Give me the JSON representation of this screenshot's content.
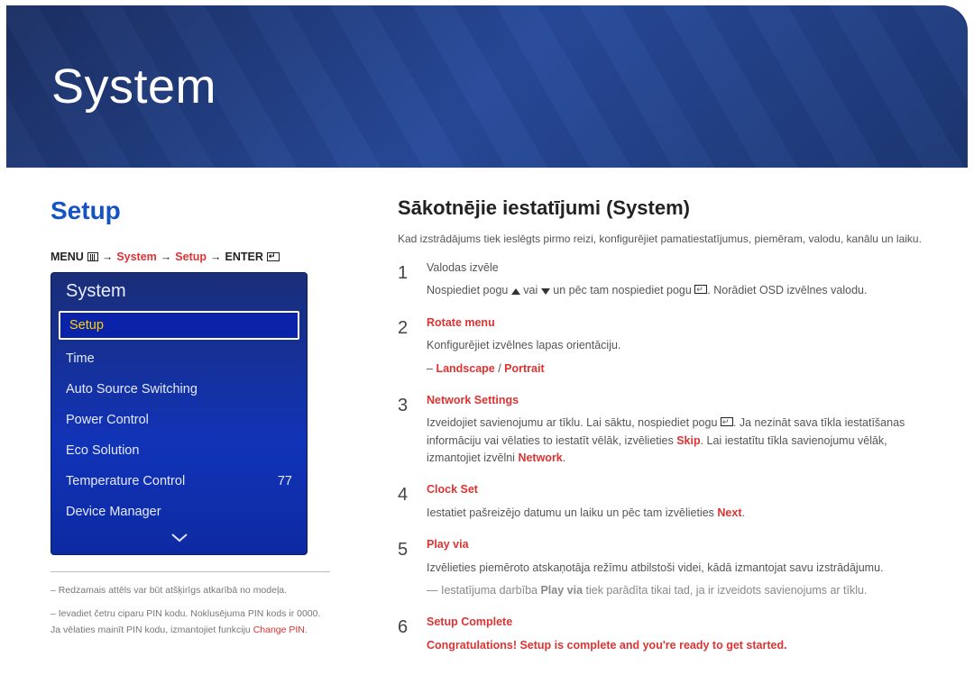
{
  "hero": {
    "title": "System"
  },
  "section": {
    "title": "Setup"
  },
  "menu_path": {
    "prefix": "MENU",
    "arrow": "→",
    "system": "System",
    "setup": "Setup",
    "enter": "ENTER"
  },
  "onscreen": {
    "header": "System",
    "items": [
      {
        "label": "Setup",
        "value": "",
        "selected": true
      },
      {
        "label": "Time",
        "value": ""
      },
      {
        "label": "Auto Source Switching",
        "value": ""
      },
      {
        "label": "Power Control",
        "value": ""
      },
      {
        "label": "Eco Solution",
        "value": ""
      },
      {
        "label": "Temperature Control",
        "value": "77"
      },
      {
        "label": "Device Manager",
        "value": ""
      }
    ]
  },
  "footnotes": {
    "line1": "– Redzamais attēls var būt atšķirīgs atkarībā no modeļa.",
    "line2_pre": "– Ievadiet četru ciparu PIN kodu. Noklusējuma PIN kods ir 0000.  Ja vēlaties mainīt PIN kodu, izmantojiet funkciju ",
    "line2_hl": "Change PIN",
    "line2_post": "."
  },
  "subsection": {
    "title": "Sākotnējie iestatījumi (System)"
  },
  "intro": "Kad izstrādājums tiek ieslēgts pirmo reizi, konfigurējiet pamatiestatījumus, piemēram, valodu, kanālu un laiku.",
  "steps": {
    "s1": {
      "n": "1",
      "p1": "Valodas izvēle",
      "p2_pre": "Nospiediet pogu ",
      "p2_mid": " vai ",
      "p2_post": " un pēc tam nospiediet pogu ",
      "p2_end": ". Norādiet OSD izvēlnes valodu."
    },
    "s2": {
      "n": "2",
      "title": "Rotate menu",
      "p1": "Konfigurējiet izvēlnes lapas orientāciju.",
      "opt_dash": "–  ",
      "opt1": "Landscape",
      "slash": " / ",
      "opt2": "Portrait"
    },
    "s3": {
      "n": "3",
      "title": "Network Settings",
      "p_pre": "Izveidojiet savienojumu ar tīklu. Lai sāktu, nospiediet pogu ",
      "p_mid": ". Ja nezināt sava tīkla iestatīšanas informāciju vai vēlaties to iestatīt vēlāk, izvēlieties ",
      "skip": "Skip",
      "p_mid2": ". Lai iestatītu tīkla savienojumu vēlāk, izmantojiet izvēlni ",
      "network": "Network",
      "p_end": "."
    },
    "s4": {
      "n": "4",
      "title": "Clock Set",
      "p_pre": "Iestatiet pašreizējo datumu un laiku un pēc tam izvēlieties ",
      "next": "Next",
      "p_end": "."
    },
    "s5": {
      "n": "5",
      "title": "Play via",
      "p1": "Izvēlieties piemēroto atskaņotāja režīmu atbilstoši videi, kādā izmantojat savu izstrādājumu.",
      "p2_pre": "― Iestatījuma darbība ",
      "p2_hl": "Play via",
      "p2_post": " tiek parādīta tikai tad, ja ir izveidots savienojums ar tīklu."
    },
    "s6": {
      "n": "6",
      "title": "Setup Complete",
      "msg": "Congratulations! Setup is complete and you're ready to get started."
    }
  }
}
